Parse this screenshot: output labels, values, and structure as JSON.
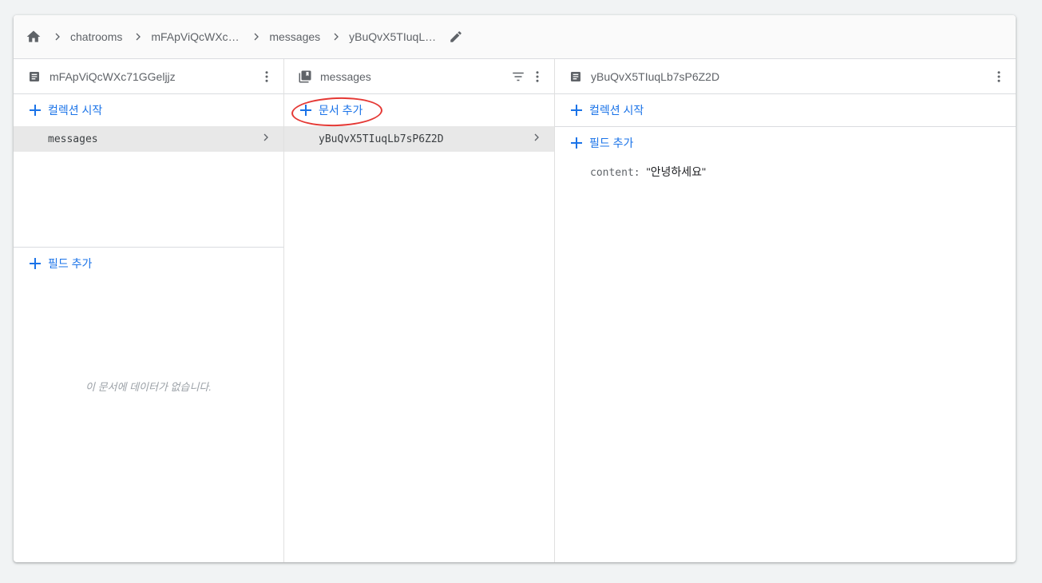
{
  "breadcrumb": {
    "items": [
      "chatrooms",
      "mFApViQcWXc7...",
      "messages",
      "yBuQvX5TIuqLb..."
    ]
  },
  "panels": [
    {
      "title": "mFApViQcWXc71GGeljjz",
      "add_collection": "컬렉션 시작",
      "items": [
        "messages"
      ],
      "add_field": "필드 추가",
      "empty_text": "이 문서에 데이터가 없습니다."
    },
    {
      "title": "messages",
      "add_document": "문서 추가",
      "items": [
        "yBuQvX5TIuqLb7sP6Z2D"
      ]
    },
    {
      "title": "yBuQvX5TIuqLb7sP6Z2D",
      "add_collection": "컬렉션 시작",
      "add_field": "필드 추가",
      "fields": [
        {
          "key": "content:",
          "value": "\"안녕하세요\""
        }
      ]
    }
  ],
  "colors": {
    "accent": "#1a73e8",
    "annotation": "#e53935",
    "selected_row": "#e8e8e8"
  },
  "icons": [
    "home-icon",
    "chevron-right-icon",
    "pencil-icon",
    "document-icon",
    "collection-icon",
    "filter-icon",
    "more-vert-icon",
    "plus-icon"
  ]
}
